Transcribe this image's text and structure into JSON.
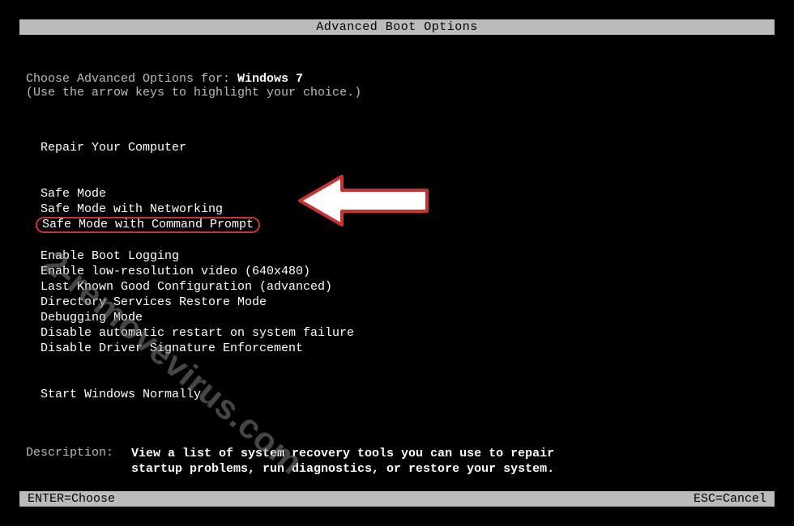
{
  "title": "Advanced Boot Options",
  "instruction": {
    "prefix": "Choose Advanced Options for: ",
    "os": "Windows 7",
    "hint": "(Use the arrow keys to highlight your choice.)"
  },
  "menu": {
    "group1": [
      "Repair Your Computer"
    ],
    "group2": [
      "Safe Mode",
      "Safe Mode with Networking",
      "Safe Mode with Command Prompt"
    ],
    "group3": [
      "Enable Boot Logging",
      "Enable low-resolution video (640x480)",
      "Last Known Good Configuration (advanced)",
      "Directory Services Restore Mode",
      "Debugging Mode",
      "Disable automatic restart on system failure",
      "Disable Driver Signature Enforcement"
    ],
    "group4": [
      "Start Windows Normally"
    ],
    "highlighted_index": 2
  },
  "description": {
    "label": "Description:",
    "text_line1": "View a list of system recovery tools you can use to repair",
    "text_line2": "startup problems, run diagnostics, or restore your system."
  },
  "footer": {
    "left": "ENTER=Choose",
    "right": "ESC=Cancel"
  },
  "watermark": "2-removevirus.com",
  "colors": {
    "highlight_border": "#c83232",
    "text_grey": "#bbbbbb",
    "text_white": "#ffffff"
  }
}
